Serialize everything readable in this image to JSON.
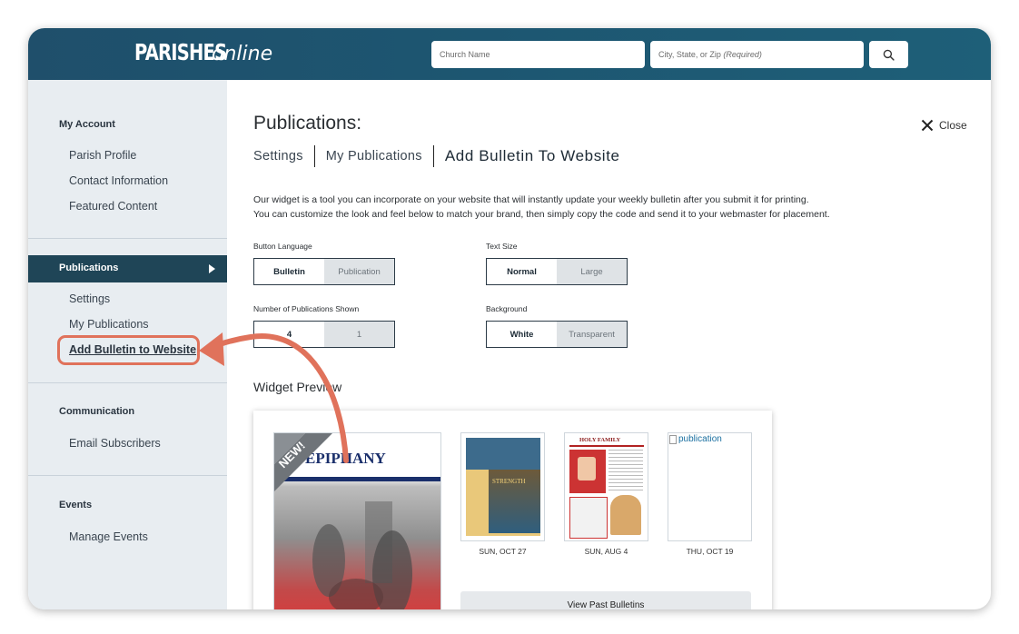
{
  "brand": {
    "word1": "PARISHES",
    "word2": "online"
  },
  "search": {
    "church_placeholder": "Church Name",
    "location_placeholder": "City, State, or Zip",
    "location_required": "(Required)"
  },
  "sidebar": {
    "account_heading": "My Account",
    "account_items": [
      "Parish Profile",
      "Contact Information",
      "Featured Content"
    ],
    "publications_heading": "Publications",
    "publications_items": [
      "Settings",
      "My Publications",
      "Add Bulletin to Website"
    ],
    "communication_heading": "Communication",
    "communication_items": [
      "Email Subscribers"
    ],
    "events_heading": "Events",
    "events_items": [
      "Manage Events"
    ]
  },
  "main": {
    "title": "Publications:",
    "close_label": "Close",
    "tabs": [
      "Settings",
      "My Publications",
      "Add Bulletin To Website"
    ],
    "description_line1": "Our widget is a tool you can incorporate on your website that will instantly update your weekly bulletin after you submit it for printing.",
    "description_line2": "You can customize the look and feel below to match your brand, then simply copy the code and send it to your webmaster for placement.",
    "button_language": {
      "label": "Button Language",
      "options": [
        "Bulletin",
        "Publication"
      ],
      "selected": "Bulletin"
    },
    "text_size": {
      "label": "Text Size",
      "options": [
        "Normal",
        "Large"
      ],
      "selected": "Normal"
    },
    "num_publications": {
      "label": "Number of Publications Shown",
      "options": [
        "4",
        "1"
      ],
      "selected": "4"
    },
    "background": {
      "label": "Background",
      "options": [
        "White",
        "Transparent"
      ],
      "selected": "White"
    },
    "widget_preview_title": "Widget Preview",
    "preview": {
      "new_badge": "NEW!",
      "cover_title": "EPIPHANY",
      "thumbs": [
        {
          "date": "SUN, OCT 27",
          "caption": "STRENGTH"
        },
        {
          "date": "SUN, AUG 4",
          "caption": "HOLY FAMILY"
        },
        {
          "date": "THU, OCT 19",
          "alt": "publication"
        }
      ],
      "past_button": "View Past Bulletins"
    }
  },
  "colors": {
    "header": "#1f4f6b",
    "sidebar_bg": "#e8edf1",
    "active_nav": "#1f4557",
    "accent_arrow": "#e0725b"
  },
  "icons": {
    "search": "search-icon",
    "close": "close-icon",
    "arrow": "chevron-right-icon"
  }
}
